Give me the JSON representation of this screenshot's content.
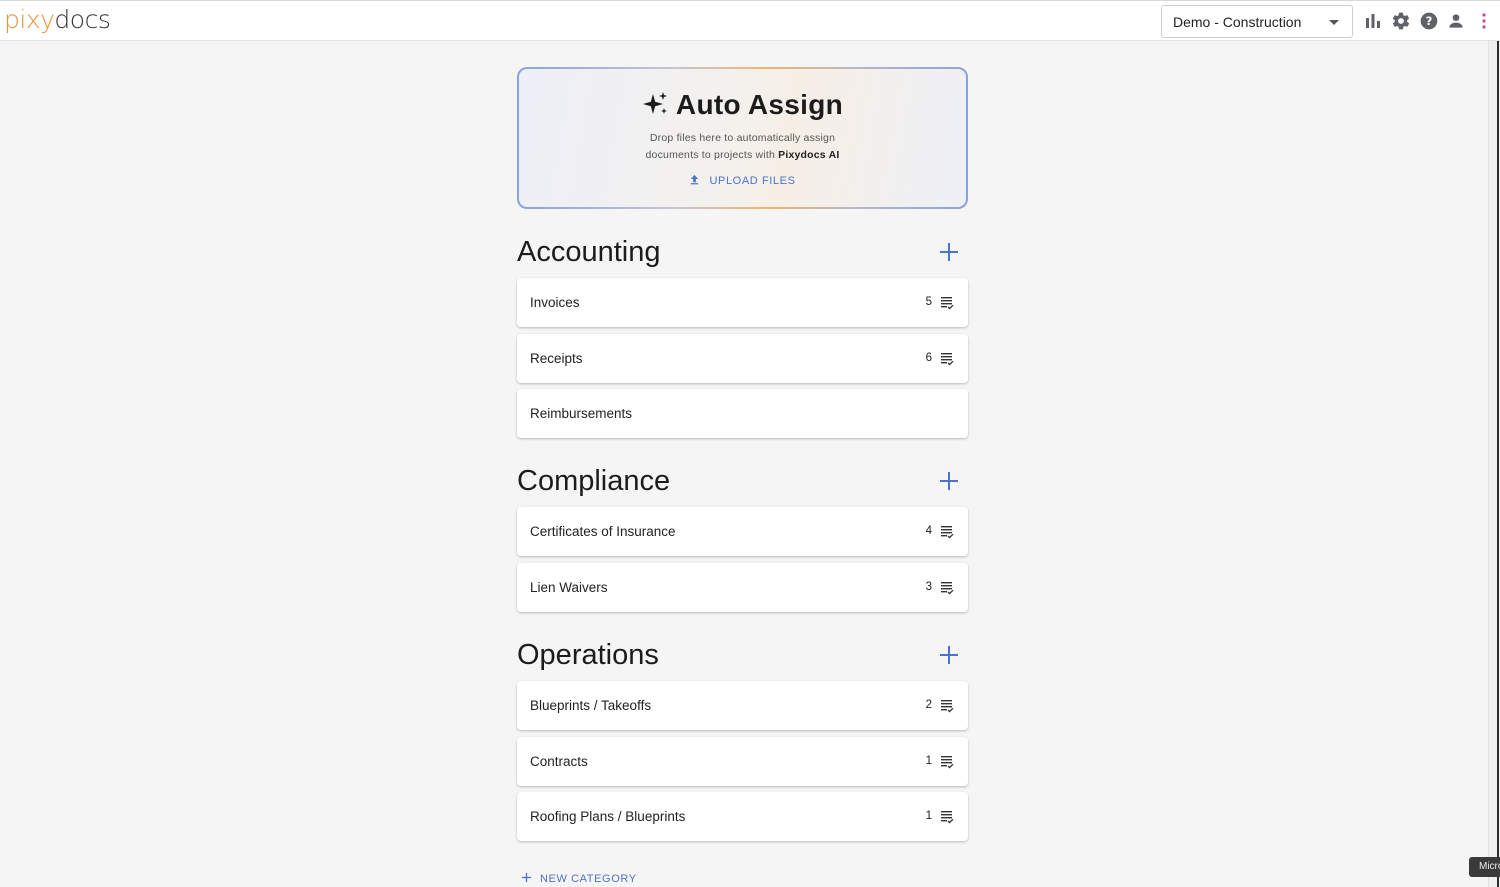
{
  "header": {
    "logo_part1": "pixy",
    "logo_part2": "docs",
    "project_select_value": "Demo - Construction",
    "icons": [
      "bar-chart-icon",
      "gear-icon",
      "help-icon",
      "user-icon",
      "more-vert-icon"
    ]
  },
  "auto_assign": {
    "title": "Auto Assign",
    "desc_line1": "Drop files here to automatically assign",
    "desc_line2_prefix": "documents to projects with ",
    "desc_line2_bold": "Pixydocs AI",
    "upload_label": "UPLOAD FILES"
  },
  "sections": [
    {
      "title": "Accounting",
      "items": [
        {
          "name": "Invoices",
          "count": "5"
        },
        {
          "name": "Receipts",
          "count": "6"
        },
        {
          "name": "Reimbursements",
          "count": ""
        }
      ]
    },
    {
      "title": "Compliance",
      "items": [
        {
          "name": "Certificates of Insurance",
          "count": "4"
        },
        {
          "name": "Lien Waivers",
          "count": "3"
        }
      ]
    },
    {
      "title": "Operations",
      "items": [
        {
          "name": "Blueprints / Takeoffs",
          "count": "2"
        },
        {
          "name": "Contracts",
          "count": "1"
        },
        {
          "name": "Roofing Plans / Blueprints",
          "count": "1"
        }
      ]
    }
  ],
  "new_category_label": "NEW CATEGORY",
  "tooltip_text": "Micro",
  "colors": {
    "accent": "#4a73c9",
    "logo_orange": "#e7933a",
    "more_icon": "#d04a8a"
  }
}
